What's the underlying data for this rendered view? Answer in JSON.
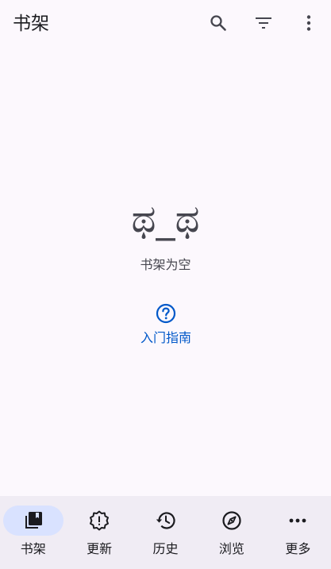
{
  "app_bar": {
    "title": "书架",
    "actions": [
      {
        "name": "search-icon"
      },
      {
        "name": "filter-icon"
      },
      {
        "name": "more-vert-icon"
      }
    ]
  },
  "empty_state": {
    "kaomoji": "ಥ_ಥ",
    "message": "书架为空",
    "guide_label": "入门指南",
    "guide_icon": "help-circle-icon"
  },
  "bottom_nav": {
    "items": [
      {
        "label": "书架",
        "icon": "library-books-icon",
        "active": true
      },
      {
        "label": "更新",
        "icon": "new-releases-icon",
        "active": false
      },
      {
        "label": "历史",
        "icon": "history-icon",
        "active": false
      },
      {
        "label": "浏览",
        "icon": "explore-icon",
        "active": false
      },
      {
        "label": "更多",
        "icon": "more-horiz-icon",
        "active": false
      }
    ]
  },
  "colors": {
    "background": "#fcf8fd",
    "accent": "#0058c9",
    "nav_background": "#f0ecf4",
    "nav_indicator": "#d9e2ff"
  }
}
